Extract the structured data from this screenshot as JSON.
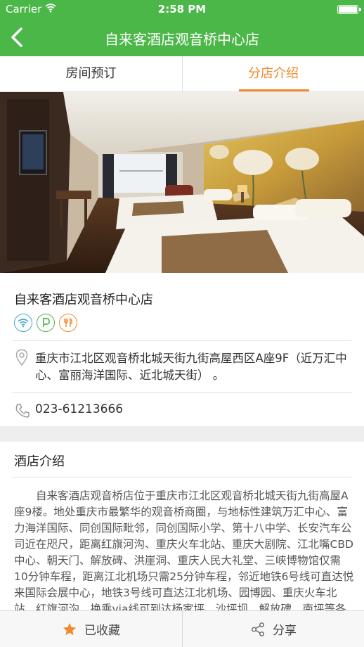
{
  "status_bar": {
    "carrier": "Carrier",
    "time": "2:58 PM"
  },
  "header": {
    "title": "自来客酒店观音桥中心店"
  },
  "tabs": [
    {
      "label": "房间预订",
      "active": false
    },
    {
      "label": "分店介绍",
      "active": true
    }
  ],
  "hotel": {
    "name": "自来客酒店观音桥中心店",
    "amenities": [
      "wifi-icon",
      "parking-icon",
      "restaurant-icon"
    ],
    "address": "重庆市江北区观音桥北城天街九街高屋西区A座9F（近万汇中心、富丽海洋国际、近北城天街）  。",
    "phone": "023-61213666"
  },
  "intro": {
    "title": "酒店介绍",
    "body": "自来客酒店观音桥店位于重庆市江北区观音桥北城天街九街高屋A座9楼。地处重庆市最繁华的观音桥商圈，与地标性建筑万汇中心、富力海洋国际、同创国际毗邻，同创国际小学、第十八中学、长安汽车公司近在咫尺，距离红旗河沟、重庆火车北站、重庆大剧院、江北嘴CBD中心、朝天门、解放碑、洪崖洞、重庆人民大礼堂、三峡博物馆仅需10分钟车程，距离江北机场只需25分钟车程，邻近地铁6号线可直达悦来国际会展中心，地铁3号线可直达江北机场、园博园、重庆火车北站、红旗河沟、换乘via线可到达杨家坪、沙坪坝、解放碑、南坪等各"
  },
  "bottom_bar": {
    "favorite_label": "已收藏",
    "share_label": "分享"
  },
  "colors": {
    "brand_green": "#4cb749",
    "accent_orange": "#f08a2c"
  }
}
